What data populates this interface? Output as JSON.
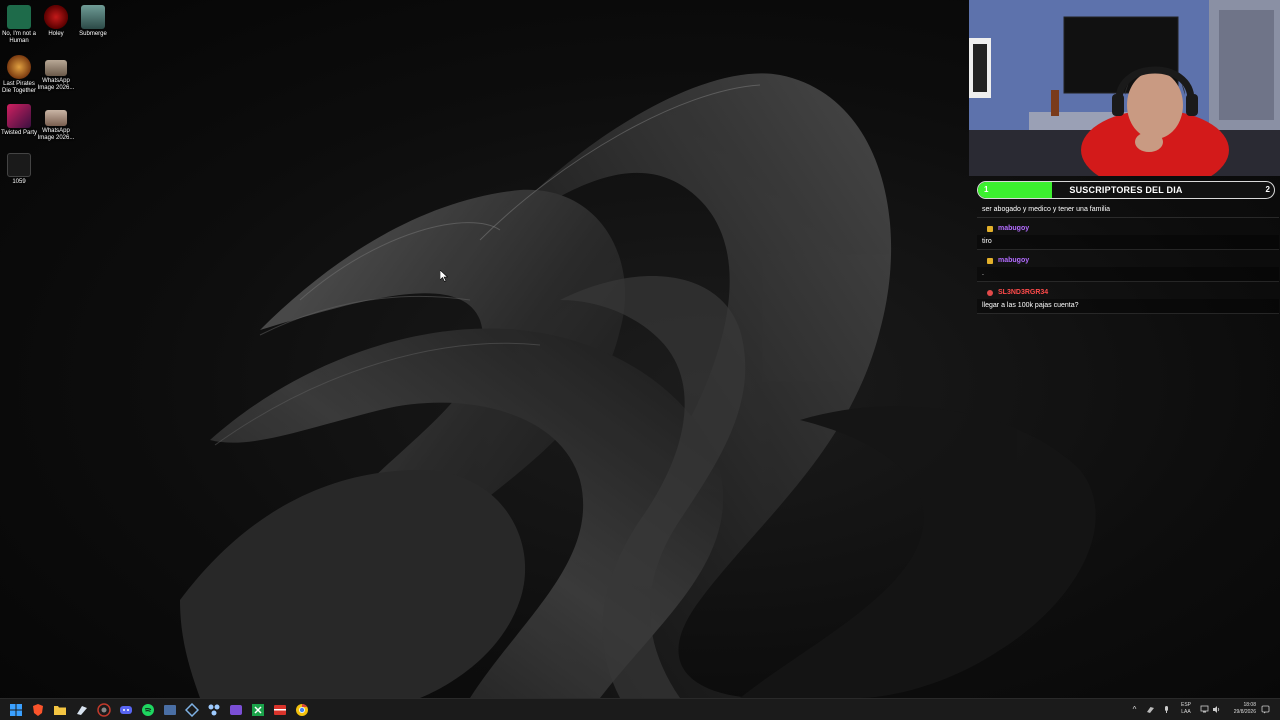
{
  "desktop": {
    "icons": [
      {
        "label": "No, I'm not a Human",
        "icon": "game-icon-mask"
      },
      {
        "label": "Holey",
        "icon": "game-icon-holey"
      },
      {
        "label": "Submerge",
        "icon": "game-icon-submerge"
      },
      {
        "label": "Last Pirates Die Together",
        "icon": "game-icon-pirates"
      },
      {
        "label": "WhatsApp Image 2026...",
        "icon": "image-file-icon"
      },
      {
        "label": "Twisted Party",
        "icon": "game-icon-twisted-party"
      },
      {
        "label": "WhatsApp Image 2026...",
        "icon": "image-file-icon"
      },
      {
        "label": "1059",
        "icon": "game-icon-1059"
      }
    ]
  },
  "stream_overlay": {
    "sub_goal": {
      "label": "SUSCRIPTORES DEL DIA",
      "start": "1",
      "goal": "2",
      "progress_fraction": 0.25,
      "fill_color": "#3cf02f"
    },
    "chat": [
      {
        "user": "",
        "text": "ser abogado y medico y tener una familia",
        "color": "#ffffff"
      },
      {
        "user": "mabugoy",
        "text": "tiro",
        "color": "#b36cff"
      },
      {
        "user": "mabugoy",
        "text": ".",
        "color": "#b36cff"
      },
      {
        "user": "SL3ND3RGR34",
        "text": "llegar a las 100k pajas cuenta?",
        "color": "#ff4a4a"
      }
    ]
  },
  "taskbar": {
    "icons": [
      "windows-start-icon",
      "brave-browser-icon",
      "file-explorer-icon",
      "steam-icon",
      "chrome-alt-icon",
      "discord-icon",
      "spotify-icon",
      "app-window-icon",
      "network-app-icon",
      "puzzle-app-icon",
      "purple-app-icon",
      "green-app-icon",
      "red-app-icon",
      "chrome-icon"
    ],
    "tray": {
      "language_top": "ESP",
      "language_bottom": "LAA",
      "time": "18:08",
      "date": "29/8/2026"
    }
  }
}
